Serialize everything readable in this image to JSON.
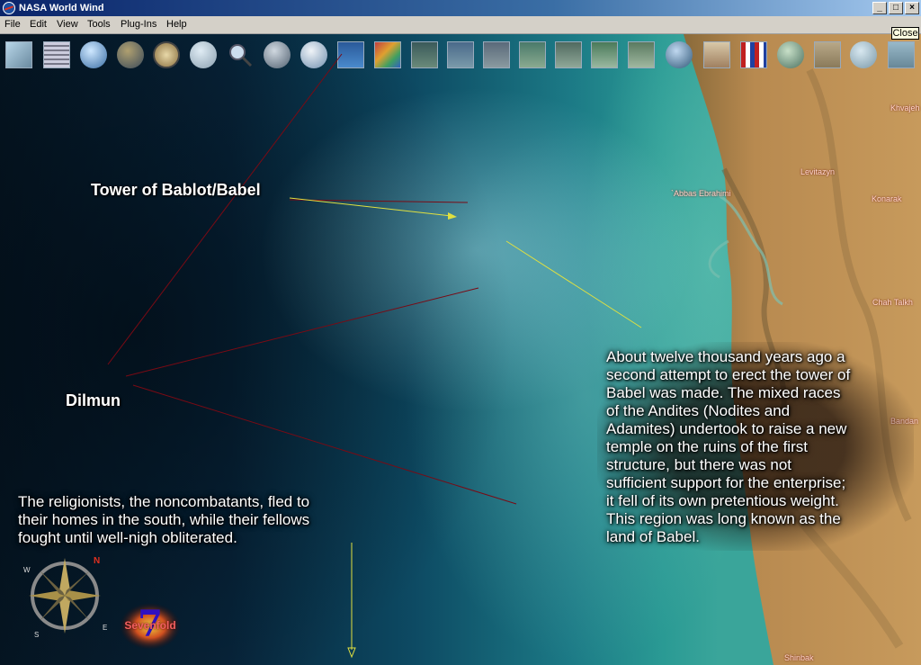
{
  "window": {
    "title": "NASA World Wind"
  },
  "menu": [
    "File",
    "Edit",
    "View",
    "Tools",
    "Plug-Ins",
    "Help"
  ],
  "tooltip": "Close",
  "toolbar_icons": [
    "layers-icon",
    "grid-icon",
    "globe-icon",
    "earth-icon",
    "compass-icon",
    "cloud-icon",
    "search-icon",
    "moon-icon",
    "modis-icon",
    "wms-icon",
    "scientific-vis-icon",
    "landsat-icon",
    "landsat-icon",
    "landsat-icon",
    "landsat-icon",
    "landsat-icon",
    "landsat-icon",
    "landsat-icon",
    "world-icon",
    "map-icon",
    "flags-icon",
    "boundaries-icon",
    "placenames-icon",
    "measure-icon",
    "crosshair-icon"
  ],
  "places": [
    "`Abbas Ebrahimi",
    "Levitazyn",
    "Khvajeh",
    "Konarak",
    "Chah Talkh",
    "Bandan",
    "Shinbak"
  ],
  "annotations": {
    "tower_label": "Tower of Bablot/Babel",
    "dilmun_label": "Dilmun",
    "left_text": [
      "The religionists, the noncombatants, fled to",
      "their homes in the south, while their fellows",
      "fought until well-nigh obliterated."
    ],
    "right_text": [
      "About twelve thousand years ago a",
      "second attempt to erect the tower of",
      "Babel was made. The mixed races",
      "of the Andites (Nodites and",
      "Adamites) undertook to raise a new",
      "temple on the ruins of the first",
      "structure, but there was not",
      "sufficient support for the enterprise;",
      "it fell of its own pretentious weight.",
      "This region was long known as the",
      "land of Babel."
    ]
  },
  "compass": {
    "letters": [
      "N",
      "E",
      "S",
      "W"
    ]
  },
  "badge": {
    "number": "7",
    "text": "Sevenfold"
  },
  "colors": {
    "annotation_red": "#7a0a14",
    "annotation_yellow": "#e0e040"
  }
}
